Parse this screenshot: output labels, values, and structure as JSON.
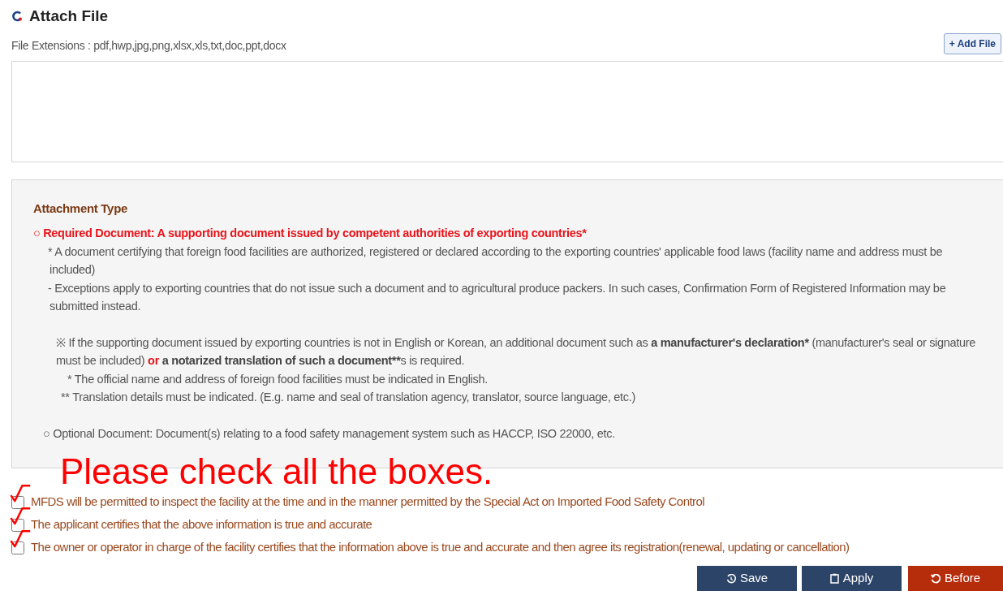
{
  "section": {
    "title": "Attach File",
    "extensions": "File Extensions : pdf,hwp,jpg,png,xlsx,xls,txt,doc,ppt,docx",
    "add_button": "+ Add File"
  },
  "attachment_panel": {
    "heading": "Attachment Type",
    "items": [
      {
        "kind": "required",
        "text": "○ Required Document: A supporting document issued by competent authorities of exporting countries*"
      },
      {
        "kind": "detail",
        "text": "* A document certifying that foreign food facilities are authorized, registered or declared according to the exporting countries' applicable food laws (facility name and address must be included)"
      },
      {
        "kind": "detail",
        "text": "- Exceptions apply to exporting countries that do not issue such a document and to agricultural produce packers. In such cases, Confirmation Form of Registered Information may be submitted instead."
      },
      {
        "kind": "note",
        "segments": [
          {
            "kind": "plain",
            "text": "※ If the supporting document issued by exporting countries is not in English or Korean, an additional document such as "
          },
          {
            "kind": "term",
            "text": "a manufacturer's declaration*"
          },
          {
            "kind": "plain",
            "text": " (manufacturer's seal or signature must be included) "
          },
          {
            "kind": "conjunction",
            "text": "or"
          },
          {
            "kind": "term",
            "text": " a notarized translation of such a document**"
          },
          {
            "kind": "plain",
            "text": "s is required."
          }
        ]
      },
      {
        "kind": "subnote",
        "text": "* The official name and address of foreign food facilities must be indicated in English."
      },
      {
        "kind": "subnote2",
        "text": "** Translation details must be indicated. (E.g. name and seal of translation agency, translator, source language, etc.)"
      },
      {
        "kind": "optional",
        "text": "○ Optional Document: Document(s) relating to a food safety management system such as HACCP, ISO 22000, etc."
      }
    ]
  },
  "annotation": "Please check all the boxes.",
  "agreements": [
    {
      "label": "MFDS will be permitted to inspect the facility at the time and in the manner permitted by the Special Act on Imported Food Safety Control",
      "checked": false
    },
    {
      "label": "The applicant certifies that the above information is true and accurate",
      "checked": false
    },
    {
      "label": "The owner or operator in charge of the facility certifies that the information above is true and accurate and then agree its registration(renewal, updating or cancellation)",
      "checked": false
    }
  ],
  "buttons": [
    {
      "kind": "save",
      "label": "Save"
    },
    {
      "kind": "apply",
      "label": "Apply"
    },
    {
      "kind": "before",
      "label": "Before"
    }
  ]
}
